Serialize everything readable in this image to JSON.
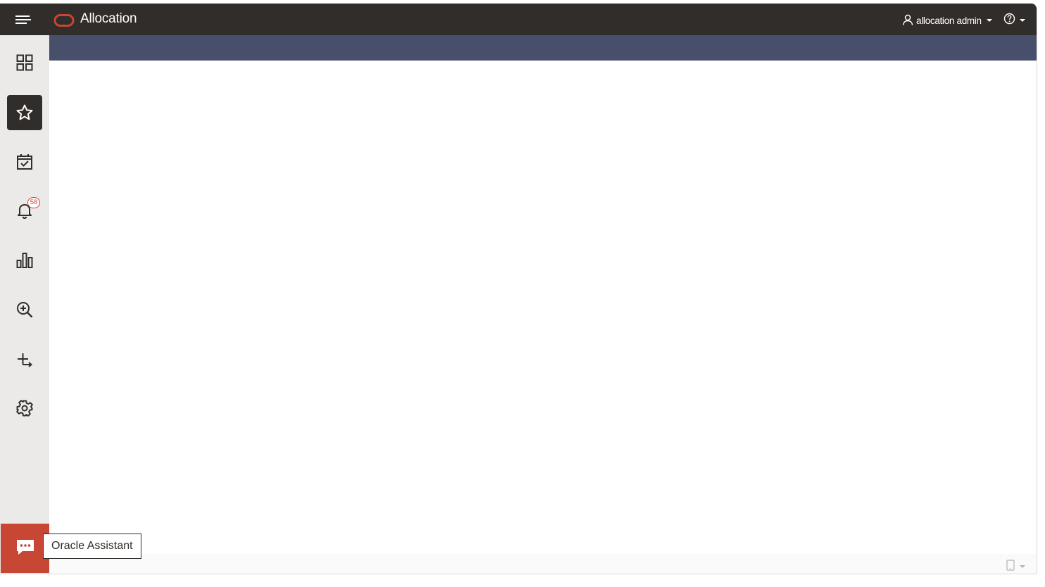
{
  "header": {
    "app_title": "Allocation",
    "user_label": "allocation admin",
    "brand_color": "#c74634",
    "bar_color": "#312d2a",
    "subbar_color": "#474f6b"
  },
  "sidebar": {
    "items": [
      {
        "name": "dashboard",
        "icon": "grid-icon",
        "active": false
      },
      {
        "name": "favorites",
        "icon": "star-icon",
        "active": true
      },
      {
        "name": "tasks",
        "icon": "calendar-check-icon",
        "active": false
      },
      {
        "name": "notifications",
        "icon": "bell-icon",
        "active": false,
        "badge": "58"
      },
      {
        "name": "reports",
        "icon": "bar-chart-icon",
        "active": false
      },
      {
        "name": "search",
        "icon": "zoom-in-icon",
        "active": false
      },
      {
        "name": "create",
        "icon": "plus-arrow-icon",
        "active": false
      },
      {
        "name": "settings",
        "icon": "gear-icon",
        "active": false
      }
    ]
  },
  "assistant": {
    "label": "Oracle Assistant",
    "icon": "chat-bubble-icon"
  }
}
